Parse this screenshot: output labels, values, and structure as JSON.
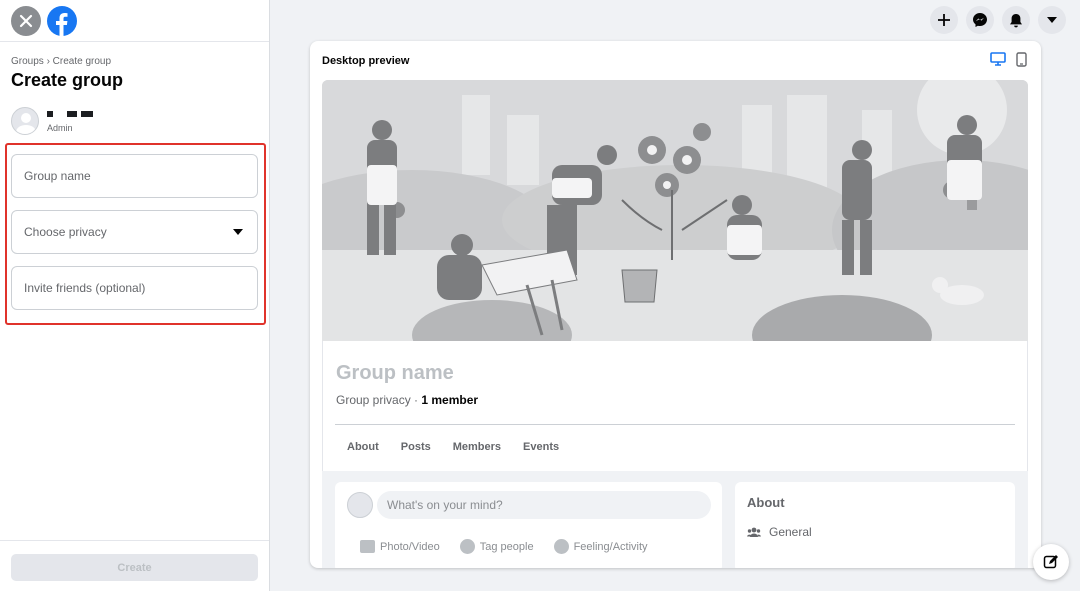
{
  "sidebar": {
    "breadcrumb": "Groups › Create group",
    "title": "Create group",
    "user": {
      "role": "Admin"
    },
    "fields": {
      "group_name_placeholder": "Group name",
      "privacy_placeholder": "Choose privacy",
      "invite_placeholder": "Invite friends (optional)"
    },
    "create_label": "Create"
  },
  "top_actions": [
    "plus-icon",
    "messenger-icon",
    "bell-icon",
    "caret-icon"
  ],
  "preview": {
    "label": "Desktop preview",
    "group_name": "Group name",
    "privacy_text": "Group privacy · ",
    "member_count": "1 member",
    "tabs": [
      "About",
      "Posts",
      "Members",
      "Events"
    ],
    "composer_placeholder": "What's on your mind?",
    "composer_actions": [
      "Photo/Video",
      "Tag people",
      "Feeling/Activity"
    ],
    "about_title": "About",
    "about_general": "General"
  },
  "colors": {
    "brand": "#1877f2",
    "highlight_border": "#e0332b"
  }
}
